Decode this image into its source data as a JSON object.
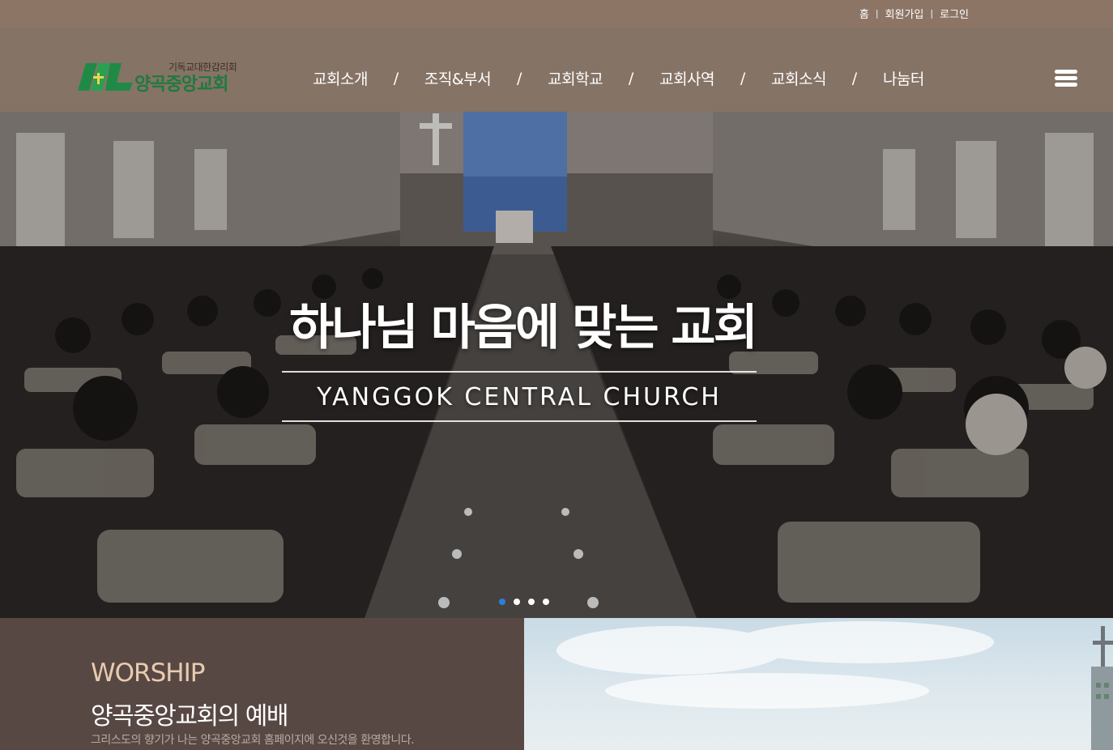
{
  "util_nav": {
    "home": "홈",
    "signup": "회원가입",
    "login": "로그인",
    "separator": "|"
  },
  "logo": {
    "subtitle": "기독교대한감리회",
    "name": "양곡중앙교회"
  },
  "nav": {
    "items": [
      "교회소개",
      "조직&부서",
      "교회학교",
      "교회사역",
      "교회소식",
      "나눔터"
    ],
    "separator": "/"
  },
  "hero": {
    "title": "하나님 마음에 맞는 교회",
    "subtitle": "YANGGOK CENTRAL CHURCH",
    "slide_count": 4,
    "active_slide": 1
  },
  "worship": {
    "eng_title": "WORSHIP",
    "kor_title": "양곡중앙교회의 예배",
    "description": "그리스도의 향기가 나는 양곡중앙교회 홈페이지에 오신것을 환영합니다."
  },
  "colors": {
    "topbar": "#8d7566",
    "header": "#826c5c",
    "accent_dot": "#2d7fd6",
    "worship_bg": "#584844",
    "worship_eng": "#e8cbb0",
    "logo_green": "#1f7a3d"
  }
}
